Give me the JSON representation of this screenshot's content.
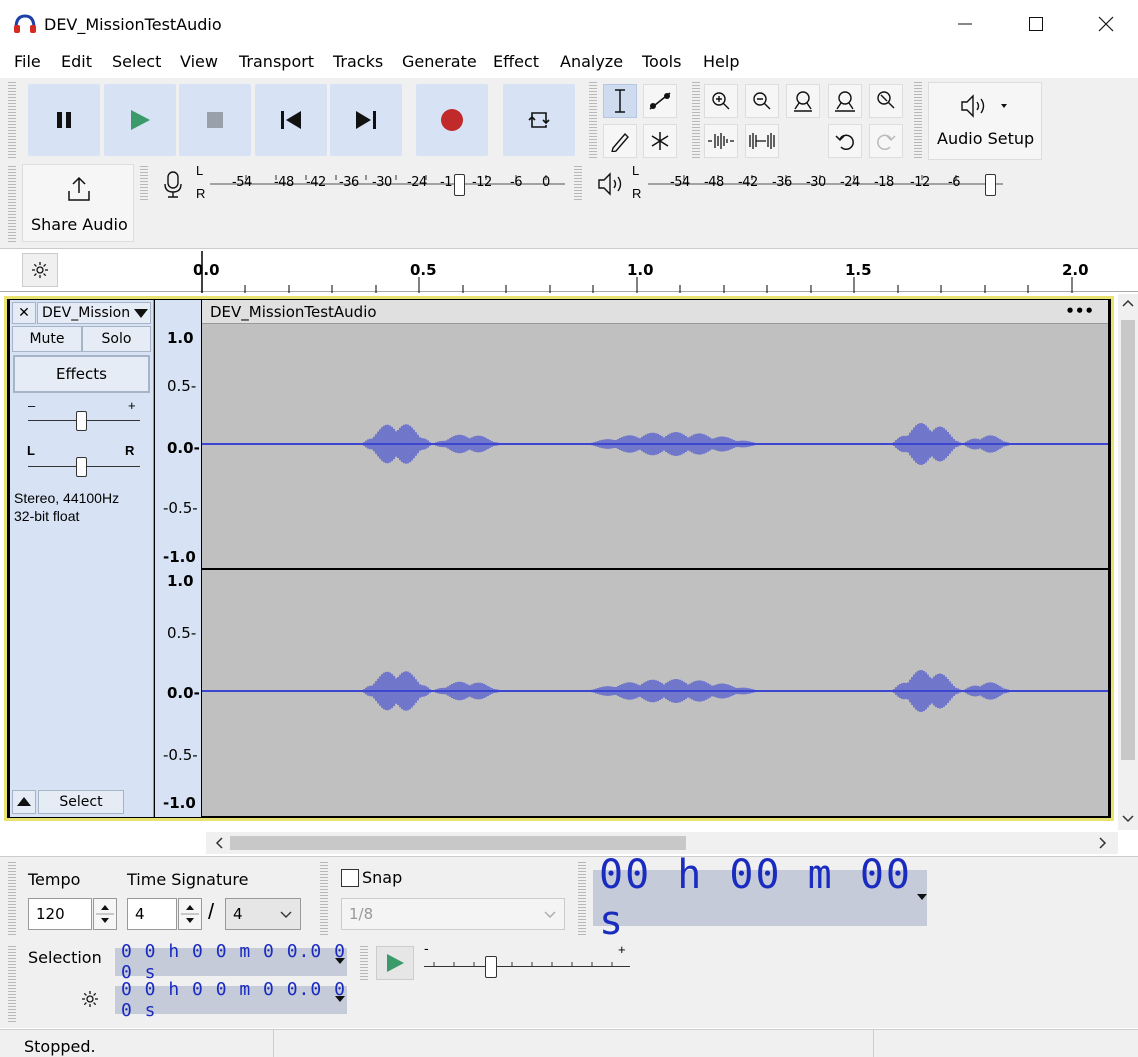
{
  "window": {
    "title": "DEV_MissionTestAudio",
    "min_label": "—",
    "max_label": "☐",
    "close_label": "✕"
  },
  "menu": [
    "File",
    "Edit",
    "Select",
    "View",
    "Transport",
    "Tracks",
    "Generate",
    "Effect",
    "Analyze",
    "Tools",
    "Help"
  ],
  "transport": {
    "pause_icon": "pause-icon",
    "play_icon": "play-icon",
    "stop_icon": "stop-icon",
    "skip_start_icon": "skip-start-icon",
    "skip_end_icon": "skip-end-icon",
    "record_icon": "record-icon",
    "loop_icon": "loop-icon",
    "play_color": "#3a9a6a",
    "record_color": "#c12a2a"
  },
  "audio_setup": {
    "label": "Audio Setup"
  },
  "share_audio": {
    "label": "Share Audio"
  },
  "record_meter": {
    "l": "L",
    "r": "R",
    "ticks": [
      "-54",
      "-48",
      "-42",
      "-36",
      "-30",
      "-24",
      "-1",
      "-12",
      "-6",
      "0"
    ]
  },
  "play_meter": {
    "l": "L",
    "r": "R",
    "ticks": [
      "-54",
      "-48",
      "-42",
      "-36",
      "-30",
      "-24",
      "-18",
      "-12",
      "-6"
    ]
  },
  "ruler": {
    "labels": [
      "0.0",
      "0.5",
      "1.0",
      "1.5",
      "2.0"
    ]
  },
  "track": {
    "name": "DEV_Mission",
    "clip_name": "DEV_MissionTestAudio",
    "clip_menu": "•••",
    "mute": "Mute",
    "solo": "Solo",
    "effects": "Effects",
    "gain_minus": "–",
    "gain_plus": "+",
    "pan_l": "L",
    "pan_r": "R",
    "info_line1": "Stereo, 44100Hz",
    "info_line2": "32-bit float",
    "select": "Select",
    "close_label": "✕"
  },
  "vruler": {
    "channel1": [
      "1.0",
      "0.5-",
      "0.0-",
      "-0.5-",
      "-1.0"
    ],
    "channel2": [
      "1.0",
      "0.5-",
      "0.0-",
      "-0.5-",
      "-1.0"
    ]
  },
  "tempo": {
    "label": "Tempo",
    "value": "120"
  },
  "time_signature": {
    "label": "Time Signature",
    "numerator": "4",
    "slash": "/",
    "denominator": "4"
  },
  "snap": {
    "label": "Snap",
    "value": "1/8"
  },
  "time_display": {
    "text": "00 h 00 m 00 s"
  },
  "selection": {
    "label": "Selection",
    "start": "0 0 h 0 0 m 0 0.0 0 0 s",
    "end": "0 0 h 0 0 m 0 0.0 0 0 s"
  },
  "play_speed": {
    "minus": "-",
    "plus": "+"
  },
  "status": {
    "text": "Stopped."
  }
}
